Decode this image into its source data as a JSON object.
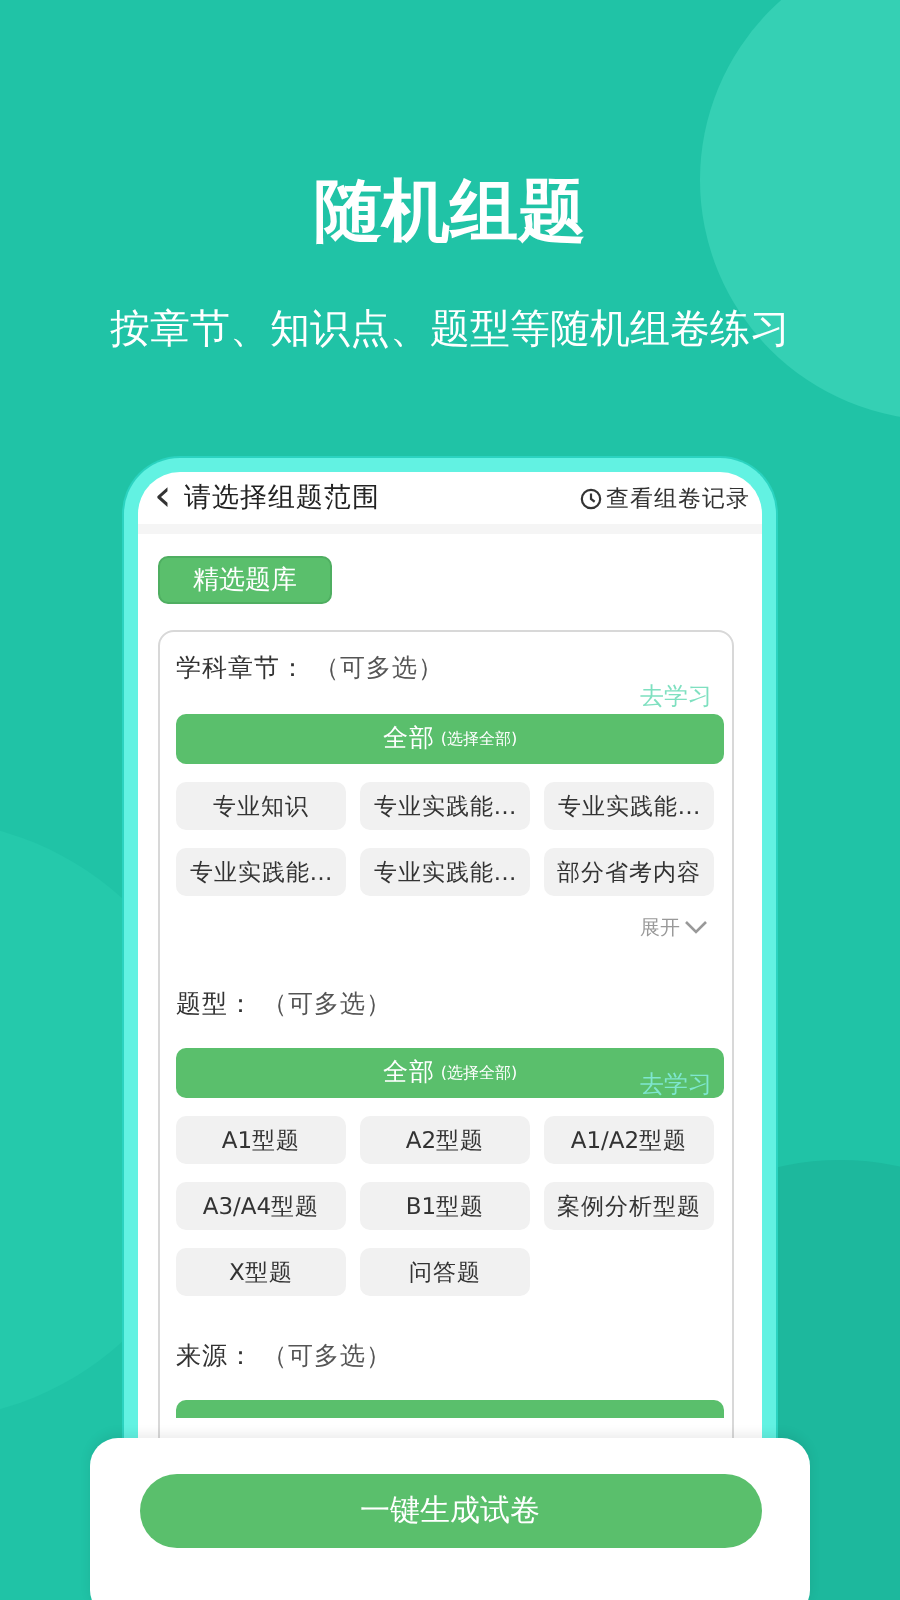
{
  "headline": "随机组题",
  "subheadline": "按章节、知识点、题型等随机组卷练习",
  "header": {
    "back": "‹",
    "title": "请选择组题范围",
    "history": "查看组卷记录"
  },
  "bank_button": "精选题库",
  "sections": [
    {
      "kind": "full",
      "title": "学科章节：",
      "hint": "（可多选）",
      "link": {
        "label": "去学习",
        "kind": "row"
      },
      "all": {
        "label": "全部",
        "hint": "(选择全部)"
      },
      "options": [
        "专业知识",
        "专业实践能…",
        "专业实践能…",
        "专业实践能…",
        "专业实践能…",
        "部分省考内容"
      ],
      "expand": "展开"
    },
    {
      "kind": "full",
      "title": "题型：",
      "hint": "（可多选）",
      "link": {
        "label": "去学习",
        "kind": "bar"
      },
      "all": {
        "label": "全部",
        "hint": "(选择全部)"
      },
      "options": [
        "A1型题",
        "A2型题",
        "A1/A2型题",
        "A3/A4型题",
        "B1型题",
        "案例分析型题",
        "X型题",
        "问答题"
      ]
    },
    {
      "kind": "covered",
      "title": "来源：",
      "hint": "（可多选）"
    }
  ],
  "generate_button": "一键生成试卷"
}
